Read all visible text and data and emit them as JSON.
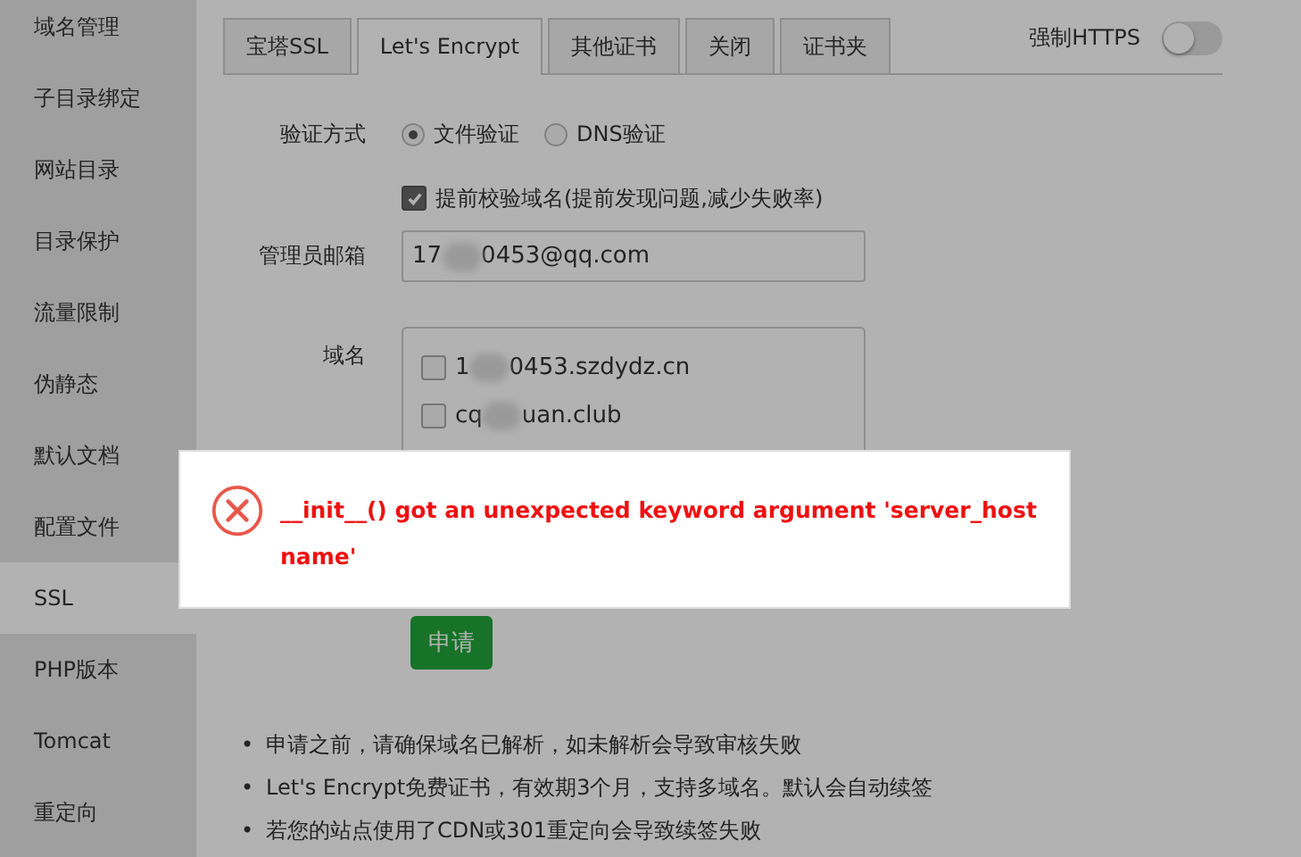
{
  "sidebar": {
    "items": [
      {
        "label": "域名管理",
        "selected": false
      },
      {
        "label": "子目录绑定",
        "selected": false
      },
      {
        "label": "网站目录",
        "selected": false
      },
      {
        "label": "目录保护",
        "selected": false
      },
      {
        "label": "流量限制",
        "selected": false
      },
      {
        "label": "伪静态",
        "selected": false
      },
      {
        "label": "默认文档",
        "selected": false
      },
      {
        "label": "配置文件",
        "selected": false
      },
      {
        "label": "SSL",
        "selected": true
      },
      {
        "label": "PHP版本",
        "selected": false
      },
      {
        "label": "Tomcat",
        "selected": false
      },
      {
        "label": "重定向",
        "selected": false
      }
    ]
  },
  "tabs": [
    {
      "label": "宝塔SSL",
      "selected": false
    },
    {
      "label": "Let's Encrypt",
      "selected": true
    },
    {
      "label": "其他证书",
      "selected": false
    },
    {
      "label": "关闭",
      "selected": false
    },
    {
      "label": "证书夹",
      "selected": false
    }
  ],
  "force_https": {
    "label": "强制HTTPS",
    "on": false
  },
  "form": {
    "verify_label": "验证方式",
    "verify_options": [
      {
        "label": "文件验证",
        "selected": true
      },
      {
        "label": "DNS验证",
        "selected": false
      }
    ],
    "precheck": {
      "label": "提前校验域名(提前发现问题,减少失败率)",
      "checked": true
    },
    "email_label": "管理员邮箱",
    "email_parts": [
      "17",
      "0453@qq.com"
    ],
    "domain_label": "域名",
    "domains": [
      {
        "parts": [
          "1",
          "0453.szdydz.cn"
        ],
        "checked": false
      },
      {
        "parts": [
          "cq",
          "uan.club"
        ],
        "checked": false
      }
    ],
    "apply_button": "申请"
  },
  "notes": [
    {
      "marker": "•",
      "text": "申请之前，请确保域名已解析，如未解析会导致审核失败"
    },
    {
      "marker": "•",
      "text": "Let's Encrypt免费证书，有效期3个月，支持多域名。默认会自动续签"
    },
    {
      "marker": "•",
      "text": "若您的站点使用了CDN或301重定向会导致续签失败"
    }
  ],
  "error_dialog": {
    "message": "__init__() got an unexpected keyword argument 'server_hostname'"
  }
}
